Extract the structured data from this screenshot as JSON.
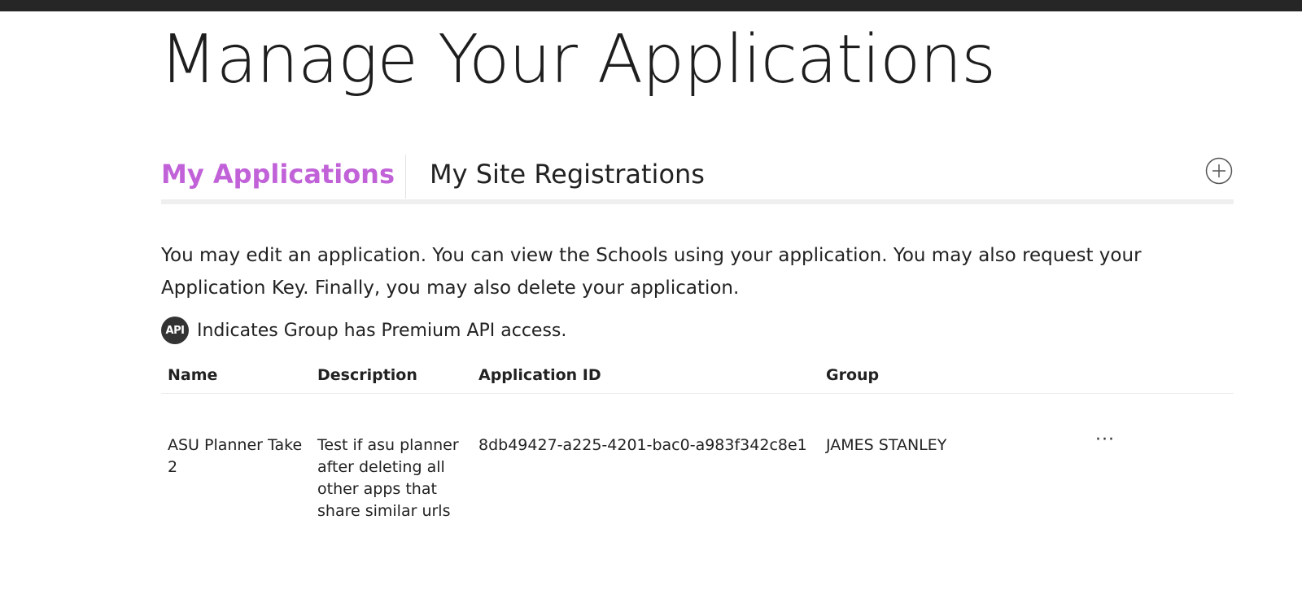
{
  "page": {
    "title": "Manage Your Applications"
  },
  "tabs": {
    "active_label": "My Applications",
    "inactive_label": "My Site Registrations"
  },
  "icons": {
    "add": "plus-circle-icon",
    "api": "api-badge-icon",
    "row_menu": "ellipsis-icon"
  },
  "intro": {
    "text": "You may edit an application. You can view the Schools using your application. You may also request your Application Key. Finally, you may also delete your application."
  },
  "api_note": {
    "badge_text": "API",
    "text": "Indicates Group has Premium API access."
  },
  "table": {
    "headers": {
      "name": "Name",
      "description": "Description",
      "application_id": "Application ID",
      "group": "Group"
    },
    "rows": [
      {
        "name": "ASU Planner Take 2",
        "description": "Test if asu planner after deleting all other apps that share similar urls",
        "application_id": "8db49427-a225-4201-bac0-a983f342c8e1",
        "group": "JAMES STANLEY",
        "menu": "···"
      }
    ]
  },
  "colors": {
    "accent": "#c162d8",
    "topbar": "#262626",
    "text": "#222222"
  }
}
